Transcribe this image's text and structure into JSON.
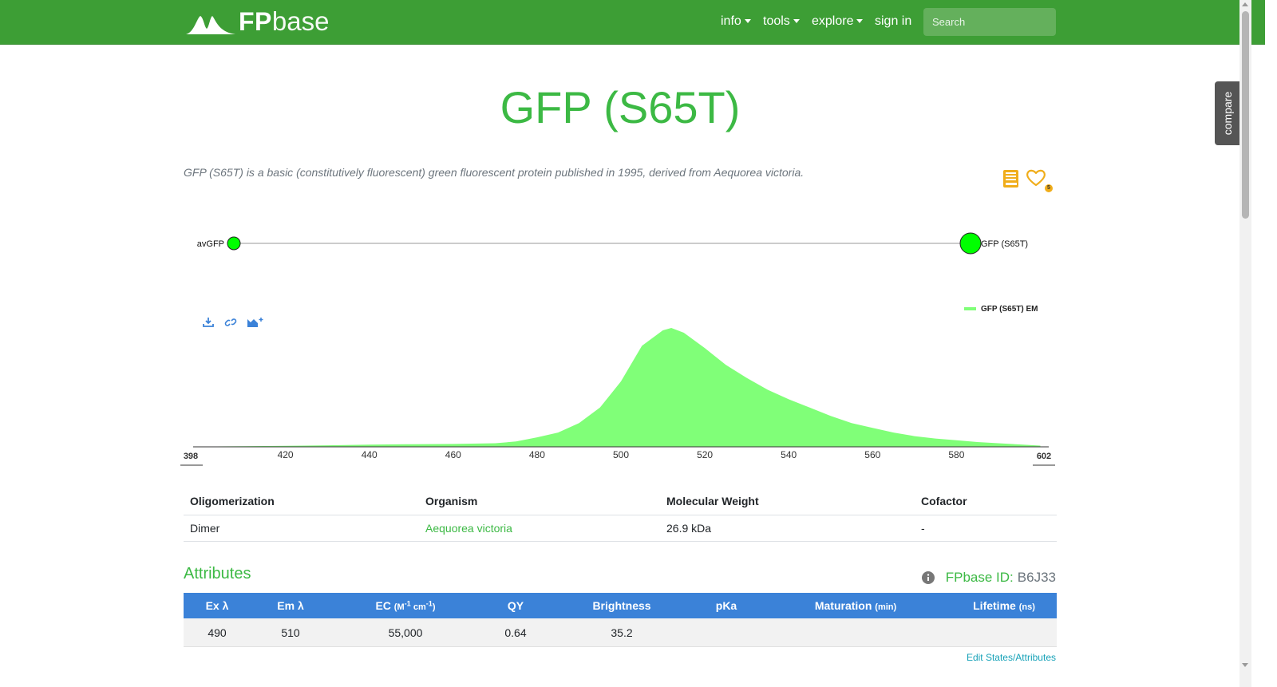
{
  "nav": {
    "logo_fp": "FP",
    "logo_base": "base",
    "items": [
      {
        "label": "info",
        "dropdown": true
      },
      {
        "label": "tools",
        "dropdown": true
      },
      {
        "label": "explore",
        "dropdown": true
      },
      {
        "label": "sign in",
        "dropdown": false
      }
    ],
    "search_placeholder": "Search"
  },
  "compare_tab": "compare",
  "protein": {
    "title": "GFP (S65T)",
    "description": "GFP (S65T) is a basic (constitutively fluorescent) green fluorescent protein published in 1995, derived from Aequorea victoria.",
    "favorites_count": "5"
  },
  "lineage": {
    "parent": "avGFP",
    "child": "GFP (S65T)",
    "node_color": "#00ff00"
  },
  "spectra_tools": [
    "download-icon",
    "link-icon",
    "add-chart-icon"
  ],
  "chart_data": {
    "type": "area",
    "series": [
      {
        "name": "GFP (S65T) EM",
        "color": "#80ff78",
        "points": [
          [
            400,
            0.003
          ],
          [
            410,
            0.005
          ],
          [
            420,
            0.008
          ],
          [
            430,
            0.013
          ],
          [
            440,
            0.018
          ],
          [
            450,
            0.022
          ],
          [
            460,
            0.024
          ],
          [
            470,
            0.03
          ],
          [
            475,
            0.045
          ],
          [
            480,
            0.08
          ],
          [
            485,
            0.12
          ],
          [
            490,
            0.2
          ],
          [
            495,
            0.33
          ],
          [
            500,
            0.55
          ],
          [
            505,
            0.85
          ],
          [
            510,
            0.98
          ],
          [
            512,
            1.0
          ],
          [
            515,
            0.96
          ],
          [
            520,
            0.83
          ],
          [
            525,
            0.69
          ],
          [
            530,
            0.58
          ],
          [
            535,
            0.48
          ],
          [
            540,
            0.4
          ],
          [
            545,
            0.33
          ],
          [
            550,
            0.26
          ],
          [
            555,
            0.2
          ],
          [
            560,
            0.16
          ],
          [
            565,
            0.12
          ],
          [
            570,
            0.09
          ],
          [
            575,
            0.07
          ],
          [
            580,
            0.055
          ],
          [
            585,
            0.04
          ],
          [
            590,
            0.03
          ],
          [
            595,
            0.02
          ],
          [
            600,
            0.01
          ]
        ]
      }
    ],
    "xlim": [
      398,
      602
    ],
    "x_range_labels": [
      "398",
      "602"
    ],
    "x_ticks": [
      420,
      440,
      460,
      480,
      500,
      520,
      540,
      560,
      580
    ],
    "legend_position": "top-right",
    "grid": false
  },
  "properties_table": {
    "headers": [
      "Oligomerization",
      "Organism",
      "Molecular Weight",
      "Cofactor"
    ],
    "row": [
      "Dimer",
      "Aequorea victoria",
      "26.9 kDa",
      "-"
    ]
  },
  "attributes": {
    "heading": "Attributes",
    "fpbase_id_label": "FPbase ID:",
    "fpbase_id": "B6J33",
    "headers": [
      {
        "label": "Ex λ",
        "unit": ""
      },
      {
        "label": "Em λ",
        "unit": ""
      },
      {
        "label": "EC",
        "unit": "(M-1 cm-1)"
      },
      {
        "label": "QY",
        "unit": ""
      },
      {
        "label": "Brightness",
        "unit": ""
      },
      {
        "label": "pKa",
        "unit": ""
      },
      {
        "label": "Maturation",
        "unit": "(min)"
      },
      {
        "label": "Lifetime",
        "unit": "(ns)"
      }
    ],
    "row": [
      "490",
      "510",
      "55,000",
      "0.64",
      "35.2",
      "",
      "",
      ""
    ],
    "edit_link": "Edit States/Attributes"
  }
}
